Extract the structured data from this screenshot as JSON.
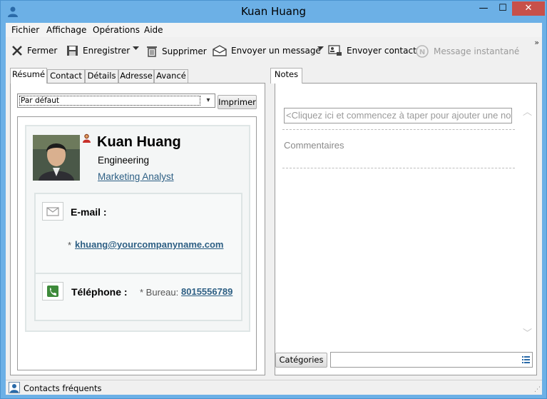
{
  "window": {
    "title": "Kuan Huang",
    "min_label": "—",
    "max_label": "☐",
    "close_label": "✕"
  },
  "menu": [
    "Fichier",
    "Affichage",
    "Opérations",
    "Aide"
  ],
  "toolbar": {
    "close": "Fermer",
    "save": "Enregistrer",
    "delete": "Supprimer",
    "send_message": "Envoyer un message",
    "send_contact": "Envoyer contact",
    "instant_message": "Message instantané",
    "overflow": "»"
  },
  "tabs": [
    "Résumé",
    "Contact",
    "Détails",
    "Adresse",
    "Avancé"
  ],
  "notes_tab": "Notes",
  "summary": {
    "view_select": "Par défaut",
    "print_button": "Imprimer",
    "name": "Kuan Huang",
    "department": "Engineering",
    "role": "Marketing Analyst",
    "email_label": "E-mail :",
    "email_bullet": "*",
    "email": "khuang@yourcompanyname.com",
    "phone_label": "Téléphone :",
    "phone_type": "* Bureau:",
    "phone": "8015556789"
  },
  "notes": {
    "input_placeholder": "<Cliquez ici et commencez à taper pour ajouter une no",
    "comments_label": "Commentaires",
    "categories_button": "Catégories"
  },
  "status": {
    "text": "Contacts fréquents"
  },
  "colors": {
    "accent": "#6cb0e6",
    "link": "#2d5f84",
    "close": "#c7504a"
  }
}
